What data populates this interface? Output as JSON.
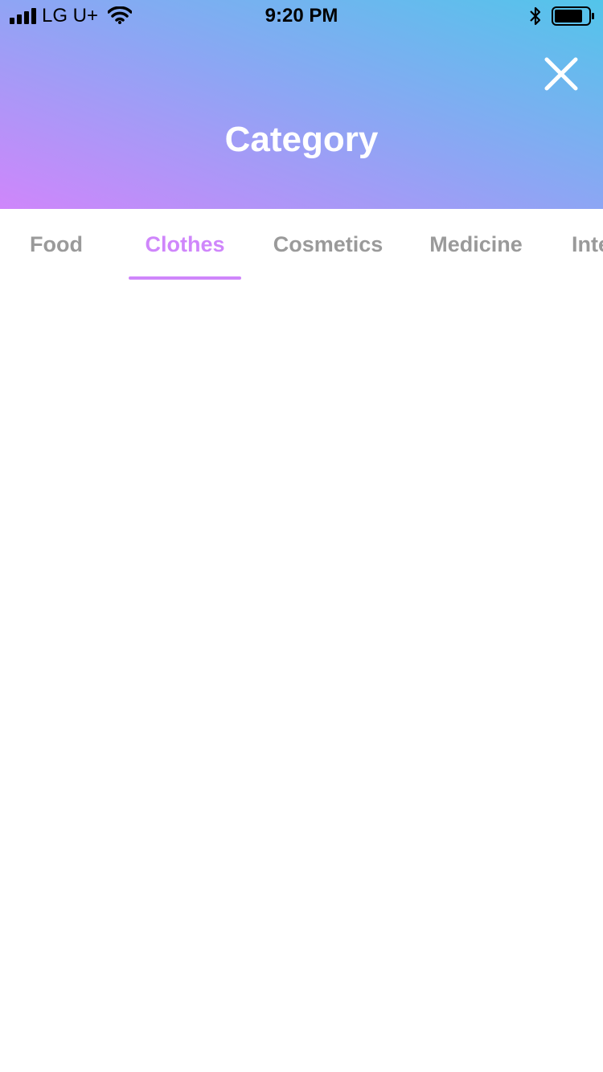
{
  "status_bar": {
    "carrier": "LG U+",
    "time": "9:20 PM",
    "icons": [
      "signal-icon",
      "wifi-icon",
      "bluetooth-icon",
      "battery-icon"
    ]
  },
  "header": {
    "title": "Category",
    "close_icon": "close-icon",
    "gradient_colors": [
      "#52c5ea",
      "#8ea5f4",
      "#cf86fb"
    ]
  },
  "tabs": {
    "selected": "Clothes",
    "accent_color": "#cf86fb",
    "inactive_color": "#9a9a9a",
    "items": [
      {
        "label": "Food"
      },
      {
        "label": "Clothes"
      },
      {
        "label": "Cosmetics"
      },
      {
        "label": "Medicine"
      },
      {
        "label": "Inte"
      }
    ]
  }
}
